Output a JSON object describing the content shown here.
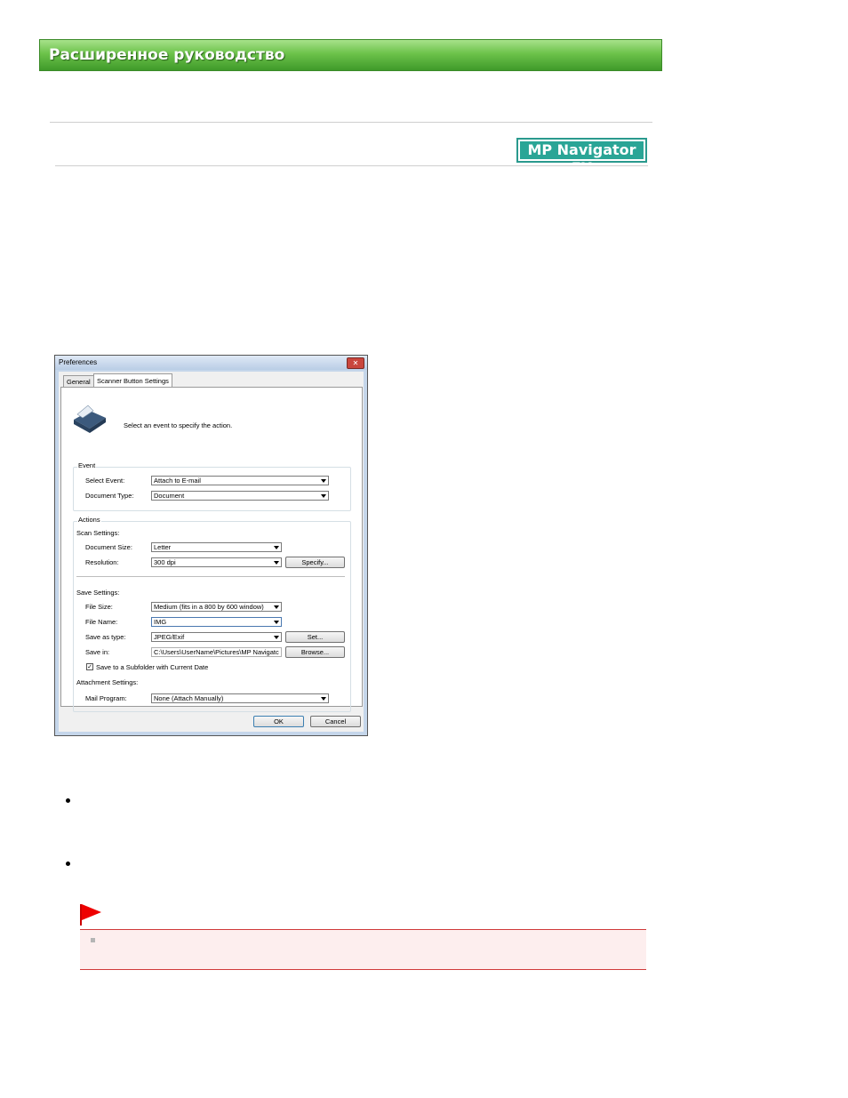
{
  "header": {
    "banner_title": "Расширенное руководство",
    "product_badge": "MP Navigator EX"
  },
  "dialog": {
    "title": "Preferences",
    "close_glyph": "✕",
    "tabs": [
      "General",
      "Scanner Button Settings"
    ],
    "intro": "Select an event to specify the action.",
    "event_group": "Event",
    "select_event_label": "Select Event:",
    "select_event_value": "Attach to E-mail",
    "document_type_label": "Document Type:",
    "document_type_value": "Document",
    "actions_group": "Actions",
    "scan_settings_label": "Scan Settings:",
    "document_size_label": "Document Size:",
    "document_size_value": "Letter",
    "resolution_label": "Resolution:",
    "resolution_value": "300 dpi",
    "specify_button": "Specify...",
    "save_settings_label": "Save Settings:",
    "file_size_label": "File Size:",
    "file_size_value": "Medium (fits in a 800 by 600 window)",
    "file_name_label": "File Name:",
    "file_name_value": "IMG",
    "save_as_type_label": "Save as type:",
    "save_as_type_value": "JPEG/Exif",
    "set_button": "Set...",
    "save_in_label": "Save in:",
    "save_in_value": "C:\\Users\\UserName\\Pictures\\MP Navigatc",
    "browse_button": "Browse...",
    "subfolder_label": "Save to a Subfolder with Current Date",
    "subfolder_checked": true,
    "attachment_settings_label": "Attachment Settings:",
    "mail_program_label": "Mail Program:",
    "mail_program_value": "None (Attach Manually)",
    "ok_button": "OK",
    "cancel_button": "Cancel"
  },
  "colors": {
    "banner_green": "#6cc24a",
    "badge_teal": "#2aa596",
    "note_red": "#d03a3a"
  }
}
